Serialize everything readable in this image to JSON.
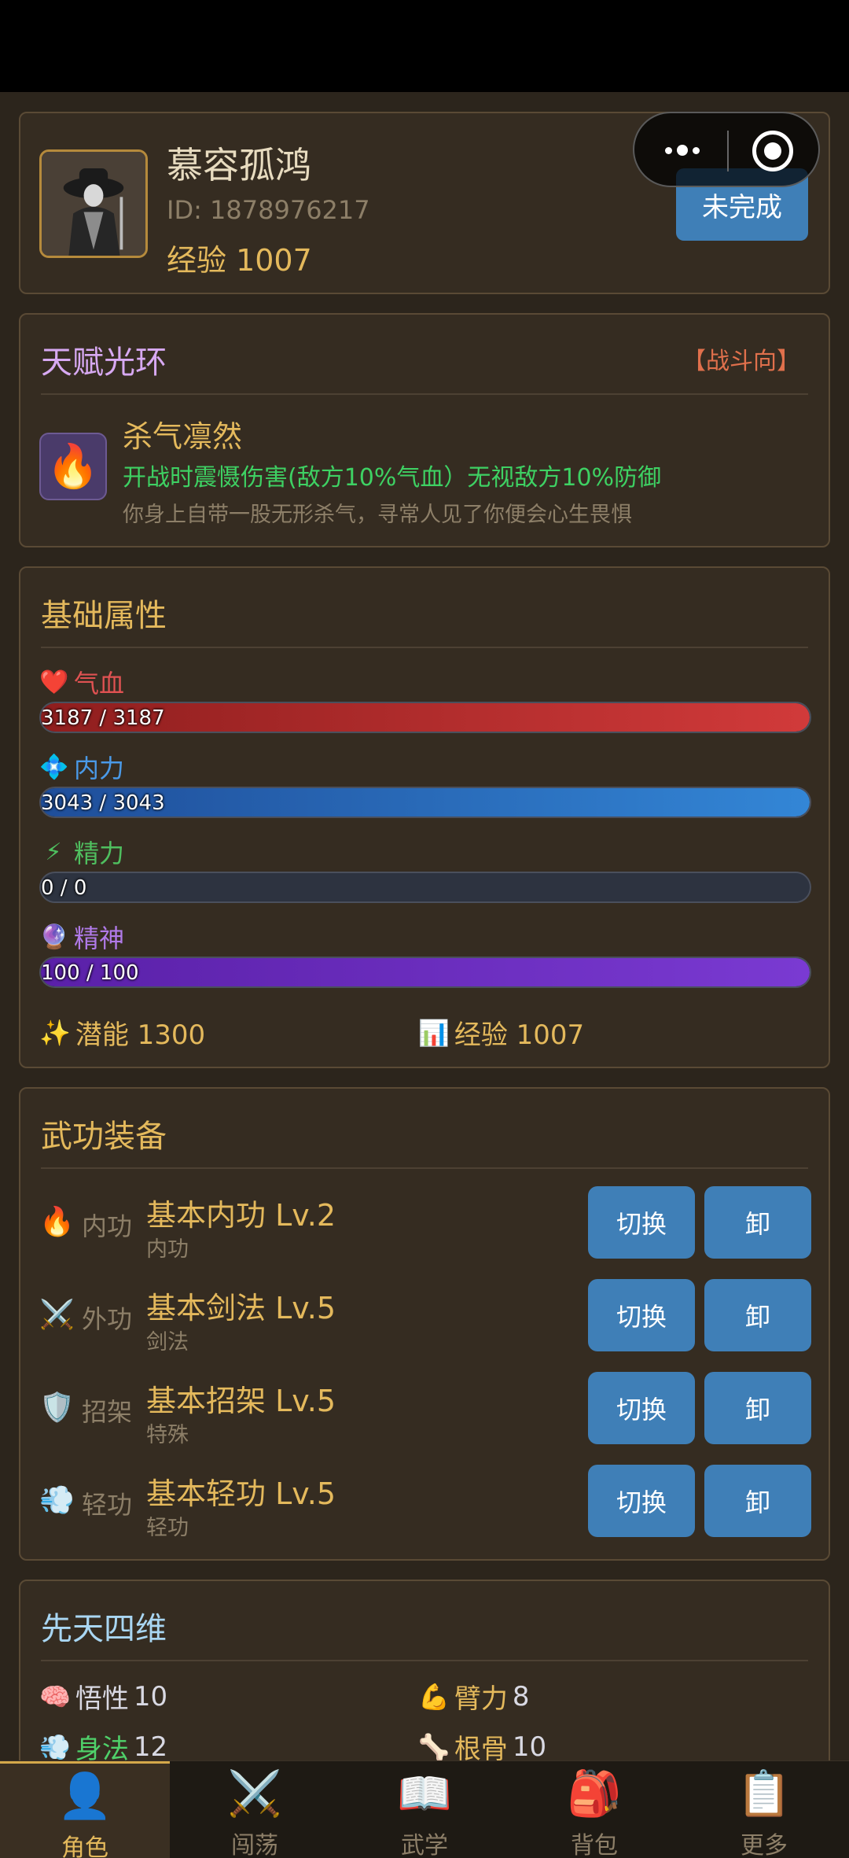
{
  "profile": {
    "name": "慕容孤鸿",
    "id_text": "ID: 1878976217",
    "exp_text": "经验 1007",
    "status_button": "未完成"
  },
  "talent": {
    "title": "天赋光环",
    "tag": "【战斗向】",
    "icon": "flame-icon",
    "name": "杀气凛然",
    "effect": "开战时震慑伤害(敌方10%气血）无视敌方10%防御",
    "description": "你身上自带一股无形杀气，寻常人见了你便会心生畏惧"
  },
  "attributes": {
    "title": "基础属性",
    "stats": [
      {
        "label": "气血",
        "icon": "heart-icon",
        "value_text": "3187 / 3187",
        "fraction": 1.0,
        "color": "#e05252",
        "bar_from": "#8f1e1e",
        "bar_to": "#d13a3a"
      },
      {
        "label": "内力",
        "icon": "diamond-icon",
        "value_text": "3043 / 3043",
        "fraction": 1.0,
        "color": "#4a9ae8",
        "bar_from": "#1f4e9a",
        "bar_to": "#3386d6"
      },
      {
        "label": "精力",
        "icon": "lightning-icon",
        "value_text": "0 / 0",
        "fraction": 0.0,
        "color": "#4fbf5f",
        "bar_from": "#2d3340",
        "bar_to": "#2d3340"
      },
      {
        "label": "精神",
        "icon": "crystal-ball-icon",
        "value_text": "100 / 100",
        "fraction": 1.0,
        "color": "#b07ae8",
        "bar_from": "#5a20a8",
        "bar_to": "#7a3ad2"
      }
    ],
    "potential_text": "潜能 1300",
    "exp_text": "经验 1007"
  },
  "martial": {
    "title": "武功装备",
    "switch_label": "切换",
    "unload_label": "卸",
    "rows": [
      {
        "type": "内功",
        "icon": "flame-icon",
        "name": "基本内功 Lv.2",
        "sub": "内功"
      },
      {
        "type": "外功",
        "icon": "crossed-swords-icon",
        "name": "基本剑法 Lv.5",
        "sub": "剑法"
      },
      {
        "type": "招架",
        "icon": "shield-icon",
        "name": "基本招架 Lv.5",
        "sub": "特殊"
      },
      {
        "type": "轻功",
        "icon": "wind-icon",
        "name": "基本轻功 Lv.5",
        "sub": "轻功"
      }
    ]
  },
  "innate": {
    "title": "先天四维",
    "stats": [
      {
        "label": "悟性",
        "value": "10",
        "icon": "brain-icon",
        "color": "#d9d9e3"
      },
      {
        "label": "臂力",
        "value": "8",
        "icon": "flexed-biceps-icon",
        "color": "#e4b95c"
      },
      {
        "label": "身法",
        "value": "12",
        "icon": "wind-icon",
        "color": "#4fd16a"
      },
      {
        "label": "根骨",
        "value": "10",
        "icon": "bone-icon",
        "color": "#e4b95c"
      }
    ]
  },
  "tabbar": {
    "tabs": [
      {
        "label": "角色",
        "icon": "person-icon",
        "active": true
      },
      {
        "label": "闯荡",
        "icon": "crossed-swords-icon",
        "active": false
      },
      {
        "label": "武学",
        "icon": "open-book-icon",
        "active": false
      },
      {
        "label": "背包",
        "icon": "backpack-icon",
        "active": false
      },
      {
        "label": "更多",
        "icon": "clipboard-icon",
        "active": false
      }
    ]
  }
}
